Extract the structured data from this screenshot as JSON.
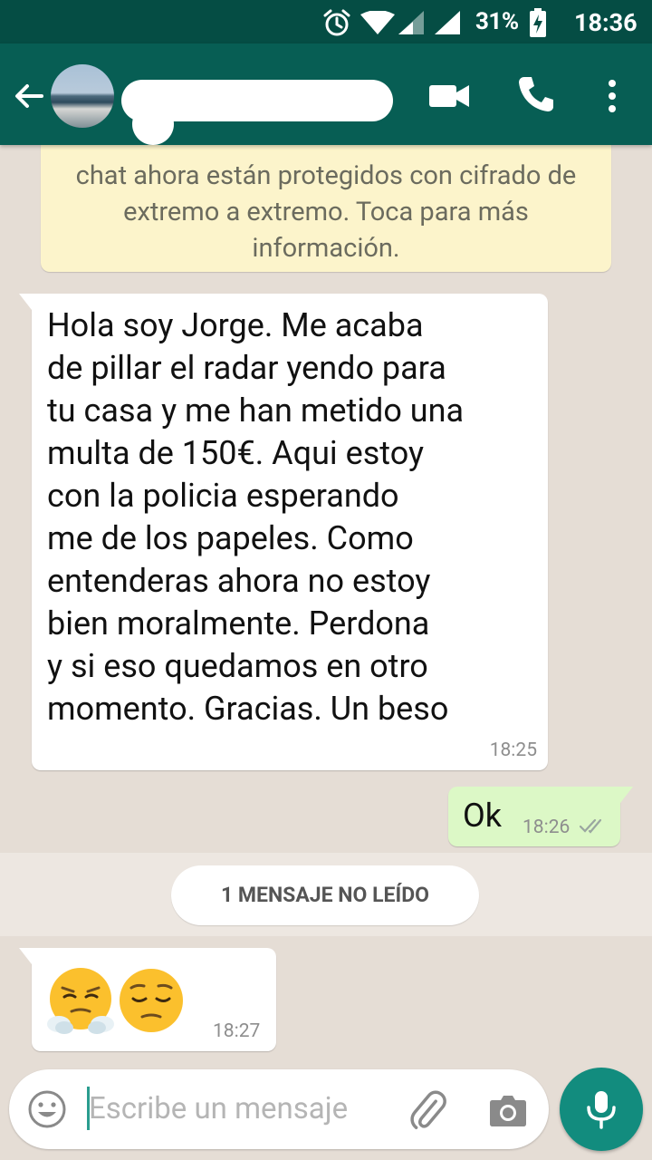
{
  "status_bar": {
    "battery_percent": "31%",
    "time": "18:36",
    "icons": [
      "alarm-icon",
      "wifi-icon",
      "signal-icon",
      "signal-icon",
      "battery-charging-icon"
    ]
  },
  "header": {
    "icons": [
      "back-arrow-icon",
      "avatar",
      "video-call-icon",
      "phone-icon",
      "more-vert-icon"
    ]
  },
  "encryption_notice": {
    "visible_text": "chat ahora están protegidos con cifrado de extremo a extremo. Toca para más información."
  },
  "messages": [
    {
      "direction": "incoming",
      "text": "Hola soy Jorge. Me acaba\nde pillar el radar yendo para\ntu casa y me han metido una\nmulta de 150€. Aqui estoy\ncon la policia esperando\nme de los papeles. Como\nentenderas ahora no estoy\nbien moralmente. Perdona\ny si eso quedamos en otro\nmomento. Gracias. Un beso",
      "time": "18:25"
    },
    {
      "direction": "outgoing",
      "text": "Ok",
      "time": "18:26",
      "status": "double-check-icon"
    },
    {
      "direction": "incoming",
      "emojis": [
        "face-with-steam-from-nose-icon",
        "pensive-face-icon"
      ],
      "time": "18:27"
    }
  ],
  "unread_banner": {
    "label": "1 MENSAJE NO LEÍDO"
  },
  "composer": {
    "placeholder": "Escribe un mensaje",
    "icons": [
      "emoji-icon",
      "attach-icon",
      "camera-icon",
      "mic-icon"
    ]
  },
  "colors": {
    "status_bar": "#054d44",
    "app_bar": "#075e54",
    "chat_background": "#e5ddd5",
    "outgoing_bubble": "#dcf8c6",
    "notice_background": "#fcf4cb",
    "mic_button": "#128c7e"
  }
}
